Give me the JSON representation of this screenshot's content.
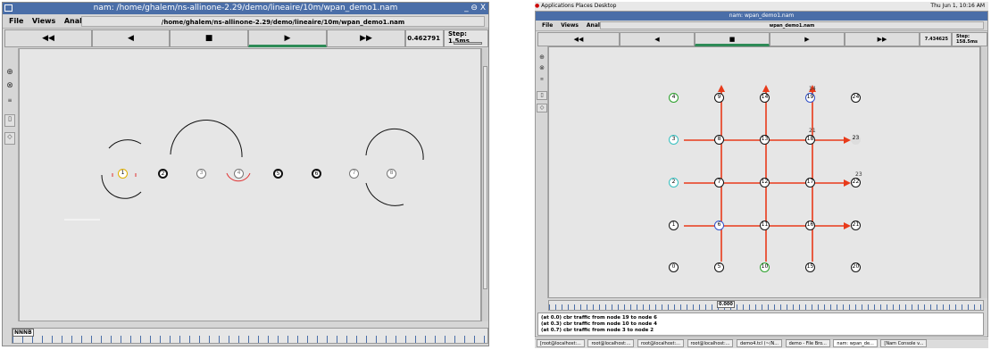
{
  "left": {
    "title": "nam: /home/ghalem/ns-allinone-2.29/demo/lineaire/10m/wpan_demo1.nam",
    "window_controls": "_ ⊖ X",
    "menu": [
      {
        "label": "File"
      },
      {
        "label": "Views"
      },
      {
        "label": "Analysis"
      }
    ],
    "path": "/home/ghalem/ns-allinone-2.29/demo/lineaire/10m/wpan_demo1.nam",
    "controls": {
      "rewind": "◀◀",
      "back": "◀",
      "stop": "■",
      "play": "▶",
      "forward": "▶▶"
    },
    "time": "0.462791",
    "step": "Step: 1.5ms",
    "timeline_label": "NNNB",
    "nodes": [
      {
        "label": "1"
      },
      {
        "label": "2"
      },
      {
        "label": "3"
      },
      {
        "label": "4"
      },
      {
        "label": "5"
      },
      {
        "label": "6"
      },
      {
        "label": "7"
      },
      {
        "label": "8"
      }
    ]
  },
  "right": {
    "topbar": "Applications  Places  Desktop",
    "clock": "Thu Jun 1, 10:16 AM",
    "title": "nam: wpan_demo1.nam",
    "menu": [
      {
        "label": "File"
      },
      {
        "label": "Views"
      },
      {
        "label": "Analysis"
      }
    ],
    "path": "wpan_demo1.nam",
    "controls": {
      "rewind": "◀◀",
      "back": "◀",
      "stop": "■",
      "play": "▶",
      "forward": "▶▶"
    },
    "time": "7.434625",
    "step": "Step: 158.5ms",
    "timeline_label": "0.000",
    "log": [
      "(at 0.0) cbr traffic from node 19 to node 6",
      "(at 0.3) cbr traffic from node 10 to node 4",
      "(at 0.7) cbr traffic from node 3 to node 2"
    ],
    "tasks": [
      {
        "label": "[root@localhost:..."
      },
      {
        "label": "root@localhost:..."
      },
      {
        "label": "root@localhost:..."
      },
      {
        "label": "root@localhost:..."
      },
      {
        "label": "demo4.tcl (~/N..."
      },
      {
        "label": "demo - File Bro..."
      },
      {
        "label": "nam: wpan_de..."
      },
      {
        "label": "[Nam Console v..."
      }
    ],
    "grid_nodes": [
      {
        "label": "4"
      },
      {
        "label": "9"
      },
      {
        "label": "14"
      },
      {
        "label": "19"
      },
      {
        "label": "24"
      },
      {
        "label": "3"
      },
      {
        "label": "8"
      },
      {
        "label": "13"
      },
      {
        "label": "18"
      },
      {
        "label": "23"
      },
      {
        "label": "2"
      },
      {
        "label": "7"
      },
      {
        "label": "12"
      },
      {
        "label": "17"
      },
      {
        "label": "22"
      },
      {
        "label": "1"
      },
      {
        "label": "6"
      },
      {
        "label": "11"
      },
      {
        "label": "16"
      },
      {
        "label": "21"
      },
      {
        "label": "0"
      },
      {
        "label": "5"
      },
      {
        "label": "10"
      },
      {
        "label": "15"
      },
      {
        "label": "20"
      }
    ],
    "annotations": [
      {
        "label": "14"
      },
      {
        "label": "21"
      },
      {
        "label": "23"
      }
    ]
  },
  "colors": {
    "titlebar": "#4a6ea8",
    "accent_green": "#2e8b57",
    "flow_red": "#e83a1a",
    "node_cyan": "#36c0c0",
    "node_green": "#2aa02a",
    "node_blue": "#3050c8"
  }
}
